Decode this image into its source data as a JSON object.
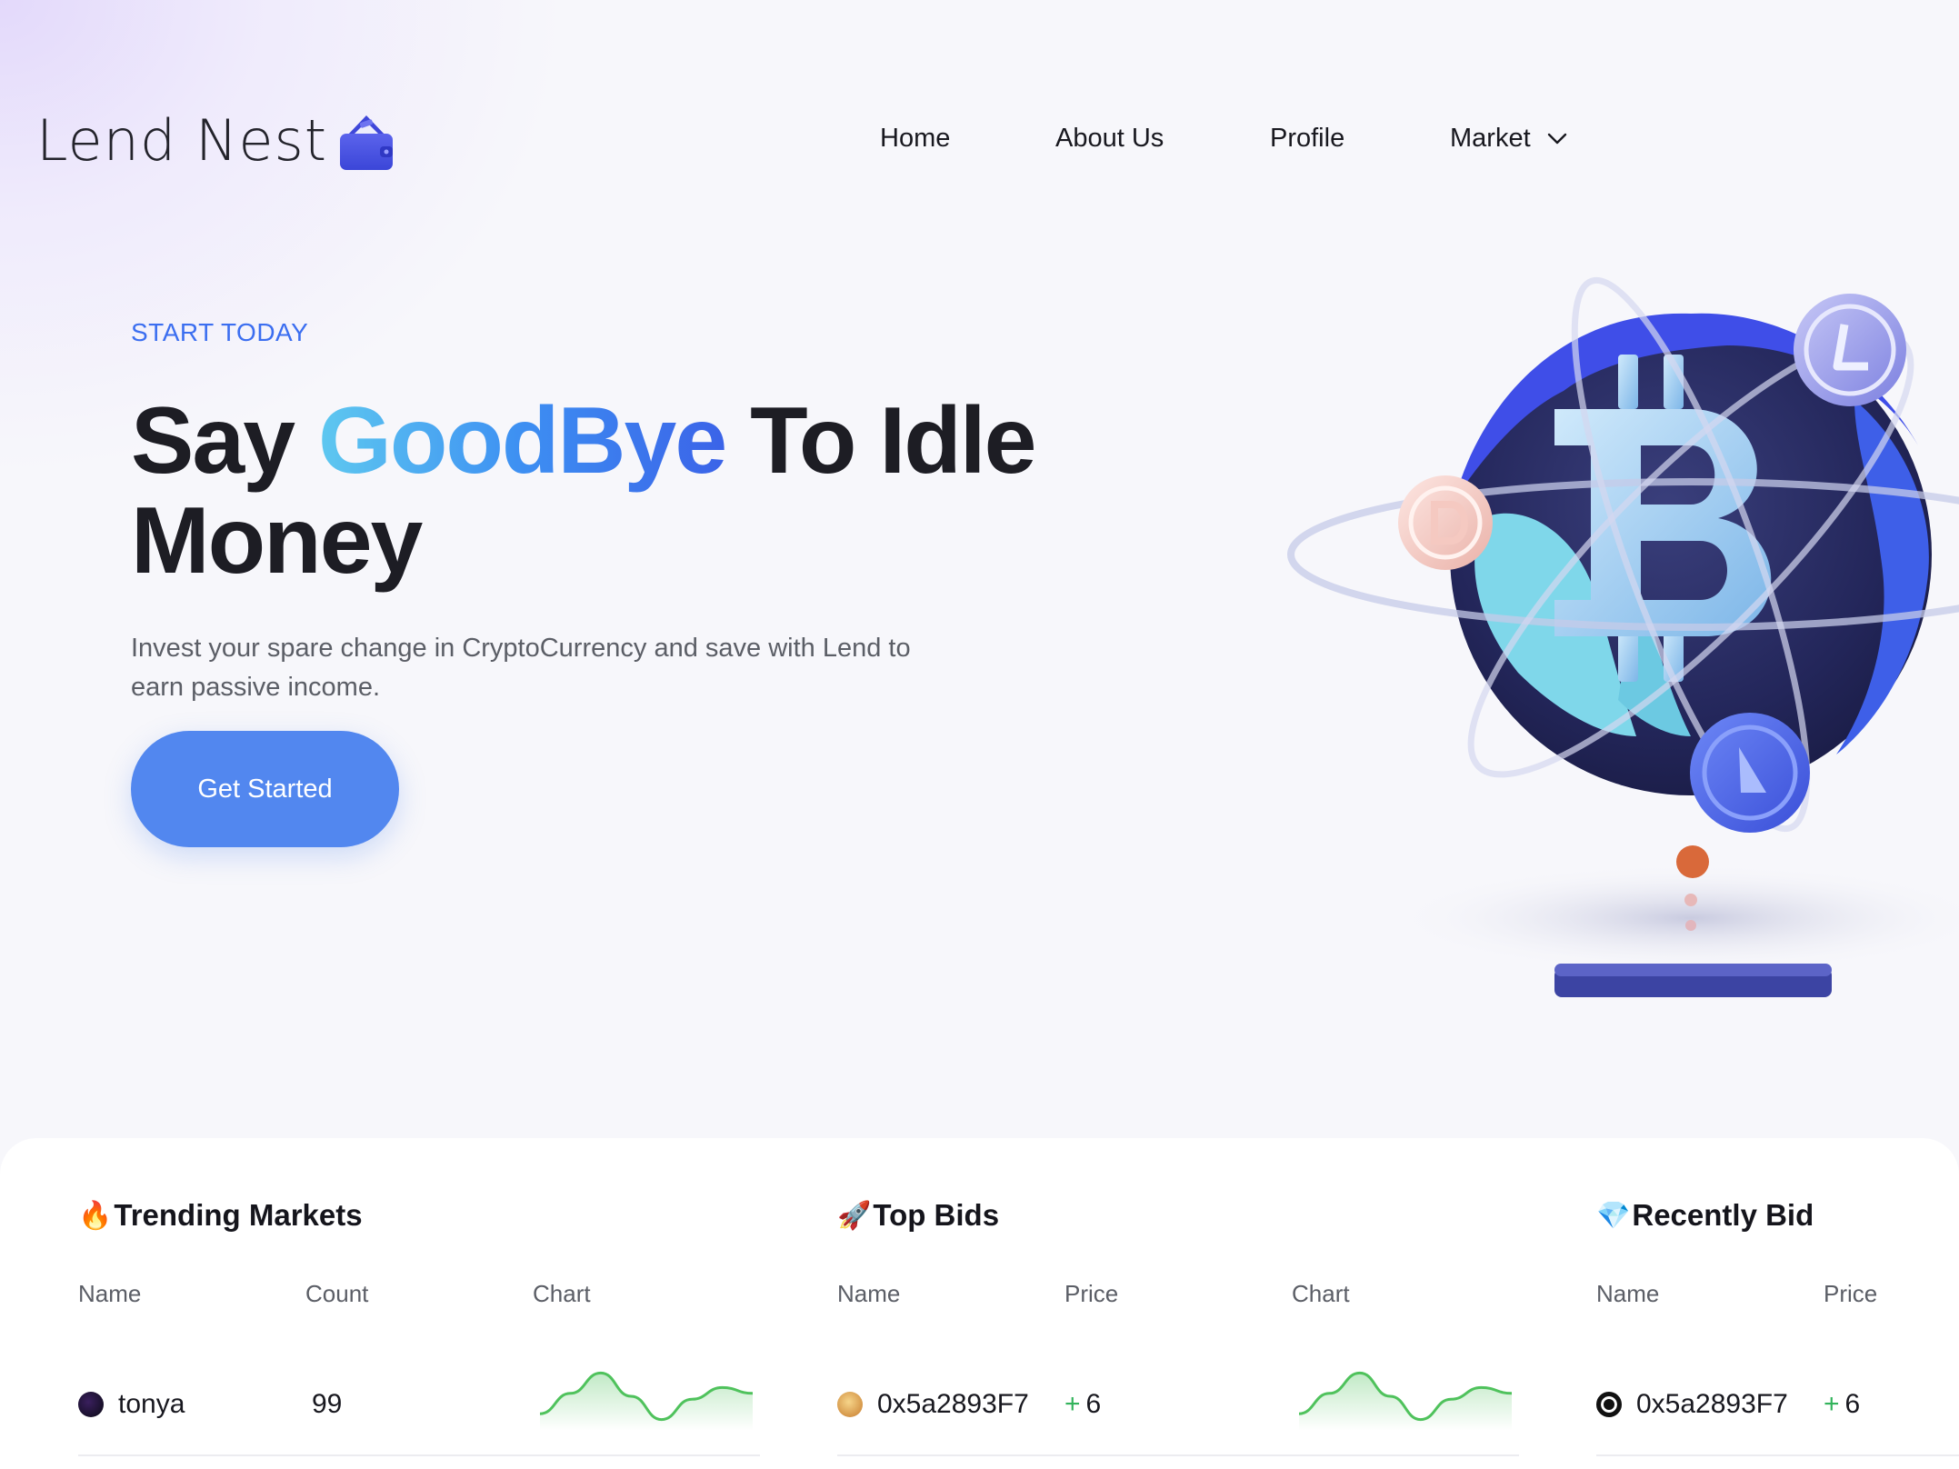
{
  "brand": {
    "name": "Lend Nest",
    "logo_icon": "wallet-house-icon",
    "accent": "#3b6ef0"
  },
  "nav": {
    "items": [
      {
        "label": "Home"
      },
      {
        "label": "About Us"
      },
      {
        "label": "Profile"
      },
      {
        "label": "Market",
        "icon": "chevron-down-icon"
      }
    ]
  },
  "hero": {
    "eyebrow": "START TODAY",
    "headline_pre": "Say ",
    "headline_highlight": "GoodBye",
    "headline_post": " To Idle Money",
    "subtitle": "Invest your spare change in CryptoCurrency and save with Lend to earn passive income.",
    "cta_label": "Get Started",
    "cta_color": "#5287ef",
    "illustration": "crypto-globe-illustration"
  },
  "sections": {
    "trending": {
      "emoji": "🔥",
      "title": "Trending Markets",
      "columns": [
        "Name",
        "Count",
        "Chart"
      ],
      "rows": [
        {
          "name": "tonya",
          "count": "99",
          "chart": [
            0.2,
            0.55,
            0.9,
            0.5,
            0.1,
            0.45,
            0.65,
            0.55
          ]
        }
      ]
    },
    "top_bids": {
      "emoji": "🚀",
      "title": "Top Bids",
      "columns": [
        "Name",
        "Price",
        "Chart"
      ],
      "rows": [
        {
          "name": "0x5a2893F7",
          "price_sign": "+",
          "price": "6",
          "chart": [
            0.2,
            0.55,
            0.9,
            0.5,
            0.1,
            0.45,
            0.65,
            0.55
          ]
        }
      ]
    },
    "recently_bid": {
      "emoji": "💎",
      "title": "Recently Bid",
      "columns": [
        "Name",
        "Price"
      ],
      "rows": [
        {
          "name": "0x5a2893F7",
          "price_sign": "+",
          "price": "6"
        }
      ]
    }
  },
  "colors": {
    "positive": "#32b35b",
    "spark_line": "#4fc25c"
  }
}
